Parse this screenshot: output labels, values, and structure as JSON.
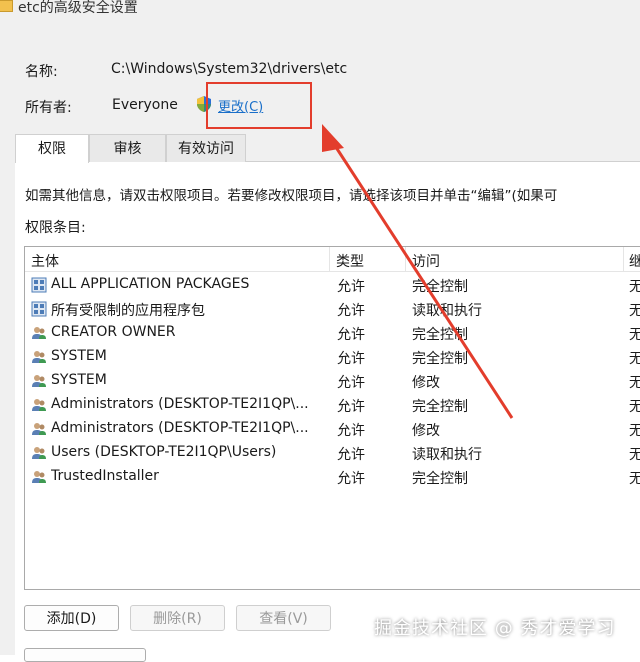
{
  "window": {
    "title": "etc的高级安全设置"
  },
  "name_row": {
    "label": "名称:",
    "value": "C:\\Windows\\System32\\drivers\\etc"
  },
  "owner_row": {
    "label": "所有者:",
    "value": "Everyone",
    "change_link": "更改(C)"
  },
  "tabs": [
    {
      "label": "权限",
      "active": true
    },
    {
      "label": "审核",
      "active": false
    },
    {
      "label": "有效访问",
      "active": false
    }
  ],
  "info_text": "如需其他信息，请双击权限项目。若要修改权限项目，请选择该项目并单击“编辑”(如果可",
  "entries_label": "权限条目:",
  "table": {
    "columns": [
      "主体",
      "类型",
      "访问",
      "继"
    ],
    "rows": [
      {
        "principal": "ALL APPLICATION PACKAGES",
        "type": "允许",
        "access": "完全控制",
        "inherit": "无",
        "icon": "app-package-icon"
      },
      {
        "principal": "所有受限制的应用程序包",
        "type": "允许",
        "access": "读取和执行",
        "inherit": "无",
        "icon": "app-package-icon"
      },
      {
        "principal": "CREATOR OWNER",
        "type": "允许",
        "access": "完全控制",
        "inherit": "无",
        "icon": "users-icon"
      },
      {
        "principal": "SYSTEM",
        "type": "允许",
        "access": "完全控制",
        "inherit": "无",
        "icon": "users-icon"
      },
      {
        "principal": "SYSTEM",
        "type": "允许",
        "access": "修改",
        "inherit": "无",
        "icon": "users-icon"
      },
      {
        "principal": "Administrators (DESKTOP-TE2I1QP\\...",
        "type": "允许",
        "access": "完全控制",
        "inherit": "无",
        "icon": "users-icon"
      },
      {
        "principal": "Administrators (DESKTOP-TE2I1QP\\...",
        "type": "允许",
        "access": "修改",
        "inherit": "无",
        "icon": "users-icon"
      },
      {
        "principal": "Users (DESKTOP-TE2I1QP\\Users)",
        "type": "允许",
        "access": "读取和执行",
        "inherit": "无",
        "icon": "users-icon"
      },
      {
        "principal": "TrustedInstaller",
        "type": "允许",
        "access": "完全控制",
        "inherit": "无",
        "icon": "users-icon"
      }
    ]
  },
  "buttons": {
    "add": "添加(D)",
    "remove": "删除(R)",
    "view": "查看(V)"
  },
  "watermark": "掘金技术社区 @ 秀才爱学习",
  "colors": {
    "link": "#1a6fc9",
    "annotation_red": "#e33d2c"
  }
}
